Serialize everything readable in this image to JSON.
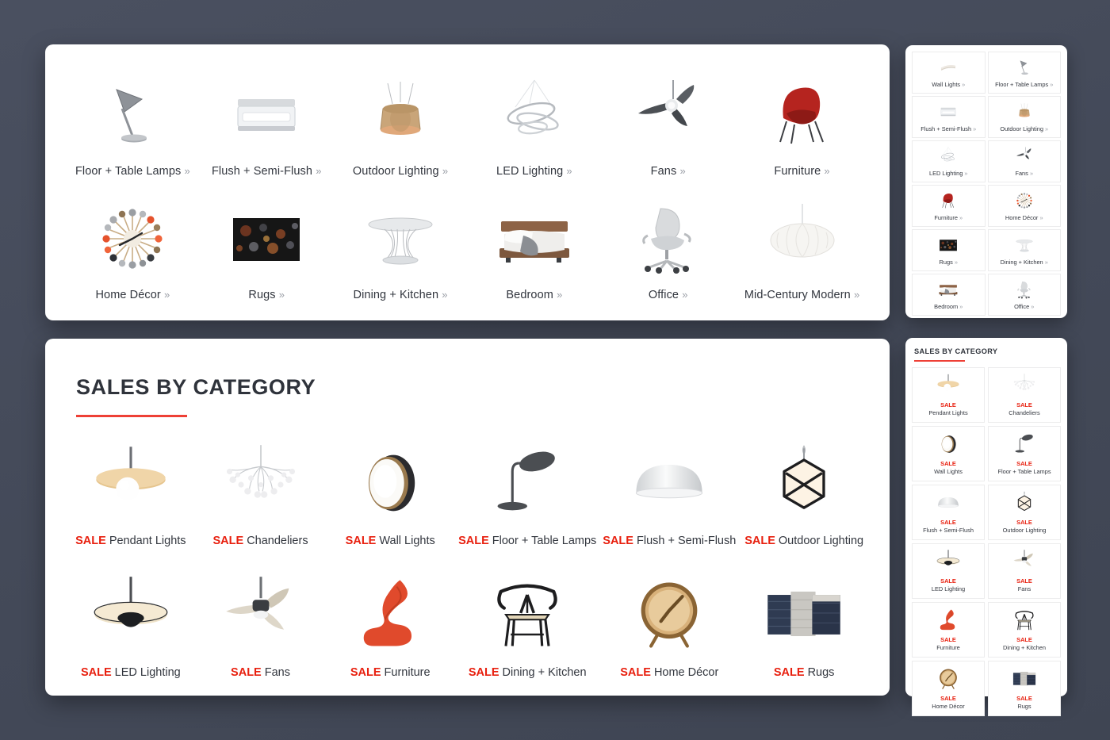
{
  "background_color": "#464c5c",
  "accent_color": "#ee4036",
  "sale_color": "#e8200f",
  "text_color": "#32363e",
  "chevron": "»",
  "categories_panel": {
    "name": "shop-by-category",
    "items": [
      {
        "label": "Floor + Table Lamps",
        "icon": "desk-lamp-icon"
      },
      {
        "label": "Flush + Semi-Flush",
        "icon": "flush-mount-icon"
      },
      {
        "label": "Outdoor Lighting",
        "icon": "woven-pendant-icon"
      },
      {
        "label": "LED Lighting",
        "icon": "led-rings-icon"
      },
      {
        "label": "Fans",
        "icon": "ceiling-fan-icon"
      },
      {
        "label": "Furniture",
        "icon": "lounge-chair-icon"
      },
      {
        "label": "Home Décor",
        "icon": "ball-clock-icon"
      },
      {
        "label": "Rugs",
        "icon": "rug-icon"
      },
      {
        "label": "Dining + Kitchen",
        "icon": "wire-table-icon"
      },
      {
        "label": "Bedroom",
        "icon": "platform-bed-icon"
      },
      {
        "label": "Office",
        "icon": "office-chair-icon"
      },
      {
        "label": "Mid-Century Modern",
        "icon": "saucer-pendant-icon"
      }
    ]
  },
  "sales_panel": {
    "title": "SALES BY CATEGORY",
    "sale_tag": "SALE",
    "items": [
      {
        "name": "Pendant Lights",
        "icon": "disc-pendant-icon"
      },
      {
        "name": "Chandeliers",
        "icon": "heracleum-chandelier-icon"
      },
      {
        "name": "Wall Lights",
        "icon": "round-wall-sconce-icon"
      },
      {
        "name": "Floor + Table Lamps",
        "icon": "leaf-table-lamp-icon"
      },
      {
        "name": "Flush + Semi-Flush",
        "icon": "dome-flush-mount-icon"
      },
      {
        "name": "Outdoor Lighting",
        "icon": "hex-lantern-icon"
      },
      {
        "name": "LED Lighting",
        "icon": "led-saucer-pendant-icon"
      },
      {
        "name": "Fans",
        "icon": "three-blade-fan-icon"
      },
      {
        "name": "Furniture",
        "icon": "panton-chair-icon"
      },
      {
        "name": "Dining + Kitchen",
        "icon": "wishbone-chair-icon"
      },
      {
        "name": "Home Décor",
        "icon": "desk-clock-icon"
      },
      {
        "name": "Rugs",
        "icon": "rug-stack-icon"
      }
    ]
  },
  "mobile_categories_panel": {
    "items": [
      {
        "label": "Wall Lights",
        "icon": "linear-sconce-icon"
      },
      {
        "label": "Floor + Table Lamps",
        "icon": "desk-lamp-icon"
      },
      {
        "label": "Flush + Semi-Flush",
        "icon": "flush-mount-icon"
      },
      {
        "label": "Outdoor Lighting",
        "icon": "woven-pendant-icon"
      },
      {
        "label": "LED Lighting",
        "icon": "led-rings-icon"
      },
      {
        "label": "Fans",
        "icon": "ceiling-fan-icon"
      },
      {
        "label": "Furniture",
        "icon": "lounge-chair-icon"
      },
      {
        "label": "Home Décor",
        "icon": "ball-clock-icon"
      },
      {
        "label": "Rugs",
        "icon": "rug-icon"
      },
      {
        "label": "Dining + Kitchen",
        "icon": "wire-table-icon"
      },
      {
        "label": "Bedroom",
        "icon": "platform-bed-icon"
      },
      {
        "label": "Office",
        "icon": "office-chair-icon"
      }
    ]
  },
  "mobile_sales_panel": {
    "title": "SALES BY CATEGORY",
    "sale_tag": "SALE",
    "items": [
      {
        "name": "Pendant Lights",
        "icon": "disc-pendant-icon"
      },
      {
        "name": "Chandeliers",
        "icon": "heracleum-chandelier-icon"
      },
      {
        "name": "Wall Lights",
        "icon": "round-wall-sconce-icon"
      },
      {
        "name": "Floor + Table Lamps",
        "icon": "leaf-table-lamp-icon"
      },
      {
        "name": "Flush + Semi-Flush",
        "icon": "dome-flush-mount-icon"
      },
      {
        "name": "Outdoor Lighting",
        "icon": "hex-lantern-icon"
      },
      {
        "name": "LED Lighting",
        "icon": "led-saucer-pendant-icon"
      },
      {
        "name": "Fans",
        "icon": "three-blade-fan-icon"
      },
      {
        "name": "Furniture",
        "icon": "panton-chair-icon"
      },
      {
        "name": "Dining + Kitchen",
        "icon": "wishbone-chair-icon"
      },
      {
        "name": "Home Décor",
        "icon": "desk-clock-icon"
      },
      {
        "name": "Rugs",
        "icon": "rug-stack-icon"
      }
    ]
  }
}
